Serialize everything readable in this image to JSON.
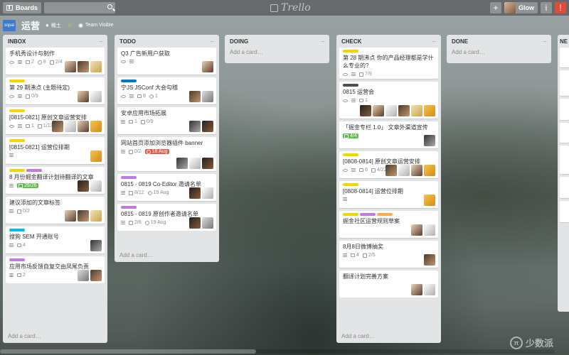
{
  "topbar": {
    "boards_label": "Boards",
    "logo_text": "Trello",
    "add_icon": "+",
    "user_name": "Glow",
    "info_icon": "i",
    "notify_icon": "!"
  },
  "board": {
    "title": "运营",
    "icon_text": "sspai",
    "team": "稀土",
    "visibility": "Team Visible"
  },
  "colors": {
    "green": "#61bd4f",
    "yellow": "#f2d600",
    "orange": "#ffab4a",
    "red": "#eb5a46",
    "purple": "#c377e0",
    "blue": "#0079bf",
    "sky": "#00c2e0",
    "black": "#4d4d4d"
  },
  "lists": [
    {
      "title": "INBOX",
      "add_card": "Add a card…",
      "cards": [
        {
          "title": "手机秀设计与制作",
          "badges": {
            "comments": "2",
            "attachments": "8",
            "checklist": "2/4"
          }
        },
        {
          "title": "第 29 期沸点 (主题待定)",
          "badges": {
            "checklist": "0/9"
          }
        },
        {
          "title": "[0815-0821] 原创文章运营安排",
          "badges": {
            "comments": "1",
            "checklist": "1/13"
          }
        },
        {
          "title": "[0815-0821] 运营位排期"
        },
        {
          "title": "8 月份掘金翻译计划待翻译的文章",
          "badges": {
            "checklist": "26/26"
          }
        },
        {
          "title": "建议添加的文章标签",
          "badges": {
            "checklist": "0/2"
          }
        },
        {
          "title": "搜狗 SEM 开通账号",
          "badges": {
            "comments": "4"
          }
        },
        {
          "title": "应用市场反馈自复交由凤尾负责",
          "badges": {
            "comments": "2"
          }
        }
      ]
    },
    {
      "title": "TODO",
      "add_card": "Add a card…",
      "cards": [
        {
          "title": "Q3 广告新用户获取"
        },
        {
          "title": "宁JS JSConf 大会勾稽",
          "badges": {
            "comments": "8",
            "attachments": "1"
          }
        },
        {
          "title": "安卓应用市场拓展",
          "badges": {
            "comments": "1",
            "checklist": "0/9"
          }
        },
        {
          "title": "网站首页添加浏览器插件 banner",
          "badges": {
            "checklist": "0/2",
            "due": "18 Aug"
          }
        },
        {
          "title": "0815 - 0819 Co-Editor 邀请名单",
          "badges": {
            "checklist": "8/12",
            "due": "19 Aug"
          }
        },
        {
          "title": "0815 - 0819 原创作者邀请名单",
          "badges": {
            "checklist": "2/6",
            "due": "19 Aug"
          }
        }
      ]
    },
    {
      "title": "DOING",
      "add_card": "Add a card…",
      "cards": []
    },
    {
      "title": "CHECK",
      "add_card": "Add a card…",
      "cards": [
        {
          "title": "第 28 期沸点 你的产品经理都是学什么专业的?",
          "badges": {
            "checklist": "7/9"
          }
        },
        {
          "title": "0815 运营会",
          "badges": {
            "comments": "1"
          }
        },
        {
          "title": "「掘金专栏 1.0」 文章外渠道宣传",
          "badges": {
            "checklist": "4/4"
          }
        },
        {
          "title": "[0808-0814] 原创文章运营安排",
          "badges": {
            "comments": "6",
            "checklist": "4/22"
          }
        },
        {
          "title": "[0808-0814] 运营位排期"
        },
        {
          "title": "掘金社区运营规则草案"
        },
        {
          "title": "8月8日微博抽奖",
          "badges": {
            "comments": "4",
            "checklist": "2/5"
          }
        },
        {
          "title": "翻译计划完善方案"
        }
      ]
    },
    {
      "title": "DONE",
      "add_card": "Add a card…",
      "cards": []
    },
    {
      "title": "NE"
    }
  ],
  "watermark": {
    "text": "少数派",
    "mark": "π"
  }
}
